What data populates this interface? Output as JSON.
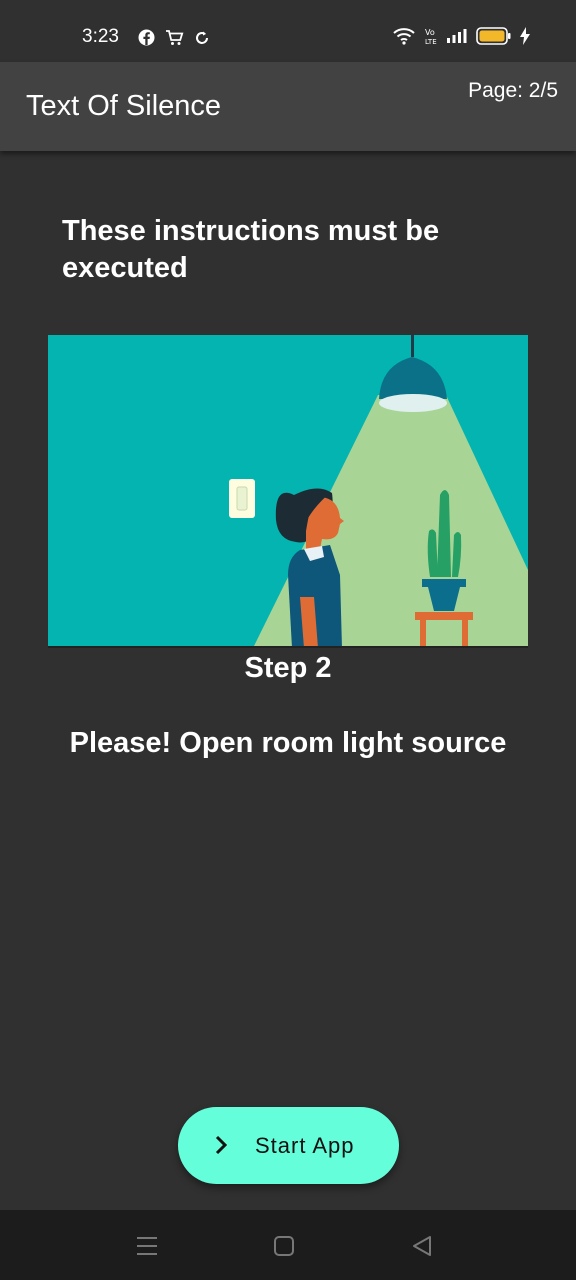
{
  "status_bar": {
    "time": "3:23",
    "left_icons": [
      "facebook-icon",
      "shopping-cart-icon",
      "sync-icon"
    ],
    "right_icons": [
      "wifi-icon",
      "volte-icon",
      "signal-icon",
      "battery-icon",
      "charging-icon"
    ]
  },
  "app_bar": {
    "title": "Text Of Silence",
    "page_indicator": "Page: 2/5"
  },
  "content": {
    "heading": "These instructions must be executed",
    "image_icon": "room-light-illustration",
    "step_label": "Step 2",
    "step_text": "Please! Open room light source"
  },
  "start_button": {
    "label": "Start App",
    "icon": "chevron-right-icon",
    "color": "#64ffda"
  },
  "nav_bar": {
    "icons": [
      "menu-icon",
      "home-icon",
      "back-icon"
    ]
  },
  "colors": {
    "background": "#303030",
    "app_bar": "#424242",
    "accent": "#64ffda",
    "illustration_bg": "#04b4b1",
    "light_cone": "#a8d596"
  }
}
